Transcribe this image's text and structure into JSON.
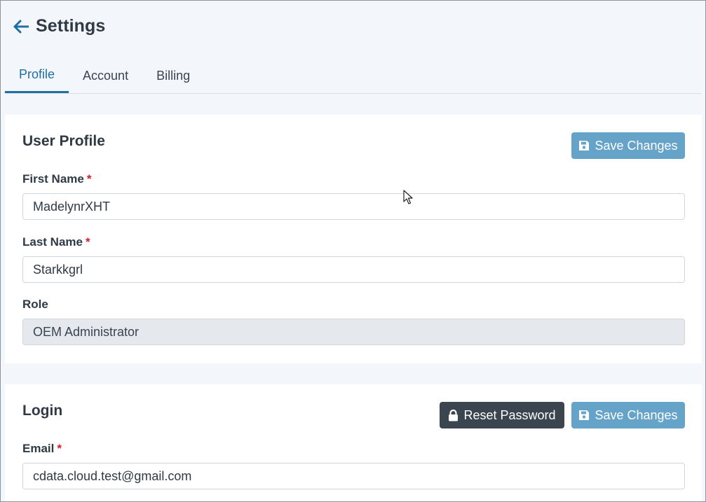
{
  "header": {
    "title": "Settings",
    "back_icon": "arrow-left-icon"
  },
  "tabs": [
    {
      "label": "Profile",
      "active": true
    },
    {
      "label": "Account",
      "active": false
    },
    {
      "label": "Billing",
      "active": false
    }
  ],
  "profile": {
    "title": "User Profile",
    "save_label": "Save Changes",
    "fields": {
      "first_name": {
        "label": "First Name",
        "required": "*",
        "value": "MadelynrXHT"
      },
      "last_name": {
        "label": "Last Name",
        "required": "*",
        "value": "Starkkgrl"
      },
      "role": {
        "label": "Role",
        "value": "OEM Administrator"
      }
    }
  },
  "login": {
    "title": "Login",
    "reset_label": "Reset Password",
    "save_label": "Save Changes",
    "fields": {
      "email": {
        "label": "Email",
        "required": "*",
        "value": "cdata.cloud.test@gmail.com"
      }
    }
  },
  "colors": {
    "accent": "#1f6fa3",
    "save_button": "#66a3c9",
    "reset_button": "#3b4550",
    "required": "#d0202a"
  }
}
